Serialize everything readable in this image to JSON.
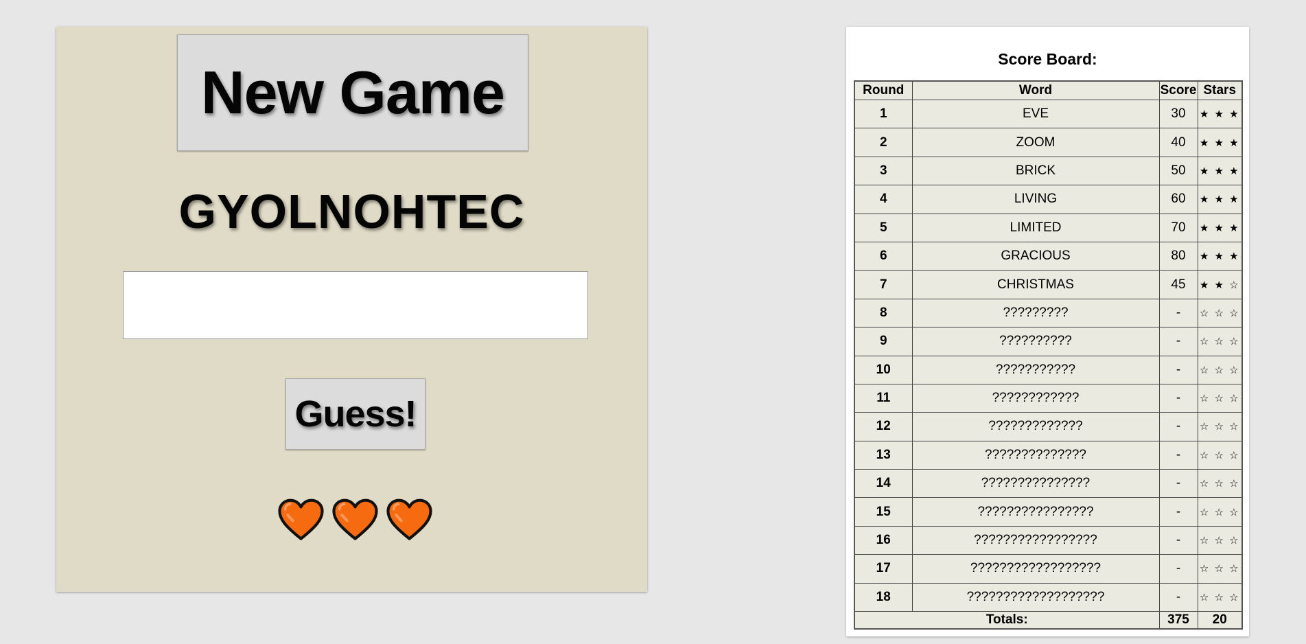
{
  "game": {
    "new_game_label": "New Game",
    "scrambled_word": "GYOLNOHTEC",
    "guess_input_value": "",
    "guess_button_label": "Guess!",
    "lives": 3,
    "heart_color": "#f66a10"
  },
  "scoreboard": {
    "title": "Score Board:",
    "columns": [
      "Round",
      "Word",
      "Score",
      "Stars"
    ],
    "rows": [
      {
        "round": "1",
        "word": "EVE",
        "score": "30",
        "stars": "★ ★ ★"
      },
      {
        "round": "2",
        "word": "ZOOM",
        "score": "40",
        "stars": "★ ★ ★"
      },
      {
        "round": "3",
        "word": "BRICK",
        "score": "50",
        "stars": "★ ★ ★"
      },
      {
        "round": "4",
        "word": "LIVING",
        "score": "60",
        "stars": "★ ★ ★"
      },
      {
        "round": "5",
        "word": "LIMITED",
        "score": "70",
        "stars": "★ ★ ★"
      },
      {
        "round": "6",
        "word": "GRACIOUS",
        "score": "80",
        "stars": "★ ★ ★"
      },
      {
        "round": "7",
        "word": "CHRISTMAS",
        "score": "45",
        "stars": "★ ★ ☆"
      },
      {
        "round": "8",
        "word": "?????????",
        "score": "-",
        "stars": "☆ ☆ ☆"
      },
      {
        "round": "9",
        "word": "??????????",
        "score": "-",
        "stars": "☆ ☆ ☆"
      },
      {
        "round": "10",
        "word": "???????????",
        "score": "-",
        "stars": "☆ ☆ ☆"
      },
      {
        "round": "11",
        "word": "????????????",
        "score": "-",
        "stars": "☆ ☆ ☆"
      },
      {
        "round": "12",
        "word": "?????????????",
        "score": "-",
        "stars": "☆ ☆ ☆"
      },
      {
        "round": "13",
        "word": "??????????????",
        "score": "-",
        "stars": "☆ ☆ ☆"
      },
      {
        "round": "14",
        "word": "???????????????",
        "score": "-",
        "stars": "☆ ☆ ☆"
      },
      {
        "round": "15",
        "word": "????????????????",
        "score": "-",
        "stars": "☆ ☆ ☆"
      },
      {
        "round": "16",
        "word": "?????????????????",
        "score": "-",
        "stars": "☆ ☆ ☆"
      },
      {
        "round": "17",
        "word": "??????????????????",
        "score": "-",
        "stars": "☆ ☆ ☆"
      },
      {
        "round": "18",
        "word": "???????????????????",
        "score": "-",
        "stars": "☆ ☆ ☆"
      }
    ],
    "totals": {
      "label": "Totals:",
      "score": "375",
      "stars": "20"
    }
  }
}
